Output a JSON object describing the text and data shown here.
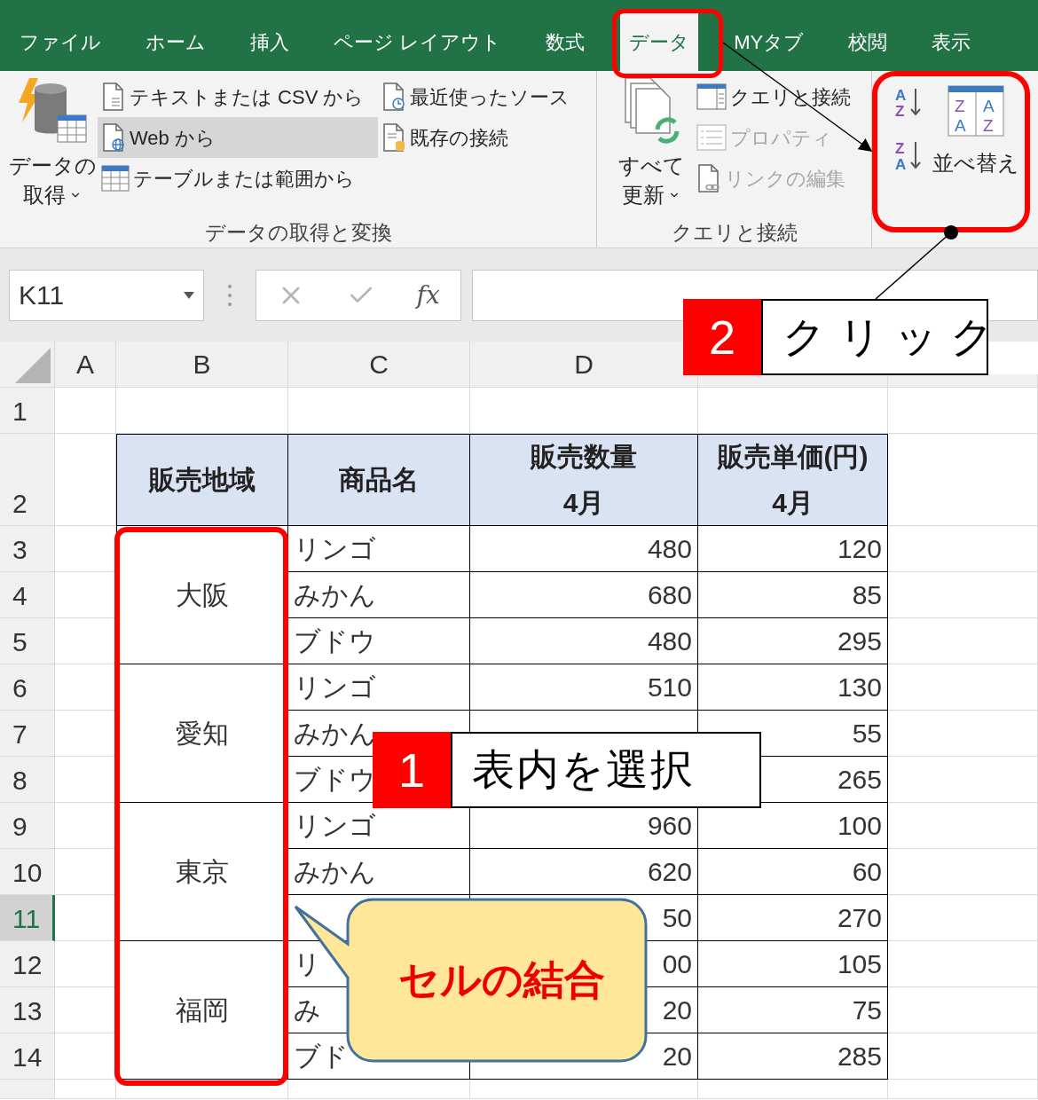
{
  "tabs": [
    {
      "label": "ファイル",
      "selected": false
    },
    {
      "label": "ホーム",
      "selected": false
    },
    {
      "label": "挿入",
      "selected": false
    },
    {
      "label": "ページ レイアウト",
      "selected": false
    },
    {
      "label": "数式",
      "selected": false
    },
    {
      "label": "データ",
      "selected": true
    },
    {
      "label": "MYタブ",
      "selected": false
    },
    {
      "label": "校閲",
      "selected": false
    },
    {
      "label": "表示",
      "selected": false
    }
  ],
  "ribbon": {
    "groups": [
      {
        "kind": "get_data",
        "title": "データの取得と変換",
        "main": [
          "データの",
          "取得"
        ],
        "columns": [
          [
            {
              "label": "テキストまたは CSV から",
              "highlighted": false,
              "disabled": false
            },
            {
              "label": "Web から",
              "highlighted": true,
              "disabled": false
            },
            {
              "label": "テーブルまたは範囲から",
              "highlighted": false,
              "disabled": false
            }
          ],
          [
            {
              "label": "最近使ったソース",
              "highlighted": false,
              "disabled": false
            },
            {
              "label": "既存の接続",
              "highlighted": false,
              "disabled": false
            }
          ]
        ]
      },
      {
        "kind": "queries",
        "title": "クエリと接続",
        "main": [
          "すべて",
          "更新"
        ],
        "columns": [
          [
            {
              "label": "クエリと接続",
              "highlighted": false,
              "disabled": false
            },
            {
              "label": "プロパティ",
              "highlighted": false,
              "disabled": true
            },
            {
              "label": "リンクの編集",
              "highlighted": false,
              "disabled": true
            }
          ]
        ]
      },
      {
        "kind": "sort",
        "main": [
          "並べ替え"
        ],
        "icon_letters": {
          "ascending": [
            "A",
            "Z"
          ],
          "descending": [
            "Z",
            "A"
          ],
          "dialog": [
            "Z",
            "A",
            "A",
            "Z"
          ]
        }
      }
    ]
  },
  "formula_bar": {
    "name_box": "K11",
    "function_label": "fx"
  },
  "sheet": {
    "columns": [
      "A",
      "B",
      "C",
      "D"
    ],
    "rows": [
      {
        "label": "1",
        "selected": false
      },
      {
        "label": "2",
        "selected": false
      },
      {
        "label": "3",
        "selected": false
      },
      {
        "label": "4",
        "selected": false
      },
      {
        "label": "5",
        "selected": false
      },
      {
        "label": "6",
        "selected": false
      },
      {
        "label": "7",
        "selected": false
      },
      {
        "label": "8",
        "selected": false
      },
      {
        "label": "9",
        "selected": false
      },
      {
        "label": "10",
        "selected": false
      },
      {
        "label": "11",
        "selected": true
      },
      {
        "label": "12",
        "selected": false
      },
      {
        "label": "13",
        "selected": false
      },
      {
        "label": "14",
        "selected": false
      }
    ],
    "table": {
      "header": [
        [
          "販売地域"
        ],
        [
          "商品名"
        ],
        [
          "販売数量",
          "4月"
        ],
        [
          "販売単価(円)",
          "4月"
        ]
      ],
      "groups": [
        {
          "region": "大阪",
          "items": [
            {
              "product": "リンゴ",
              "quantity": "480",
              "price": "120"
            },
            {
              "product": "みかん",
              "quantity": "680",
              "price": "85"
            },
            {
              "product": "ブドウ",
              "quantity": "480",
              "price": "295"
            }
          ]
        },
        {
          "region": "愛知",
          "items": [
            {
              "product": "リンゴ",
              "quantity": "510",
              "price": "130"
            },
            {
              "product": "みかん",
              "price": "55"
            },
            {
              "product": "ブドウ",
              "price": "265"
            }
          ]
        },
        {
          "region": "東京",
          "items": [
            {
              "product": "リンゴ",
              "quantity": "960",
              "price": "100"
            },
            {
              "product": "みかん",
              "quantity": "620",
              "price": "60"
            },
            {
              "quantity": "50",
              "price": "270"
            }
          ]
        },
        {
          "region": "福岡",
          "items": [
            {
              "product": "リ",
              "quantity": "00",
              "price": "105"
            },
            {
              "product": "み",
              "quantity": "20",
              "price": "75"
            },
            {
              "product": "ブド",
              "quantity": "20",
              "price": "285"
            }
          ]
        }
      ]
    }
  },
  "annotations": {
    "steps": [
      {
        "number": "1",
        "label": "表内を選択"
      },
      {
        "number": "2",
        "label": "クリック"
      }
    ],
    "callout": "セルの結合"
  }
}
